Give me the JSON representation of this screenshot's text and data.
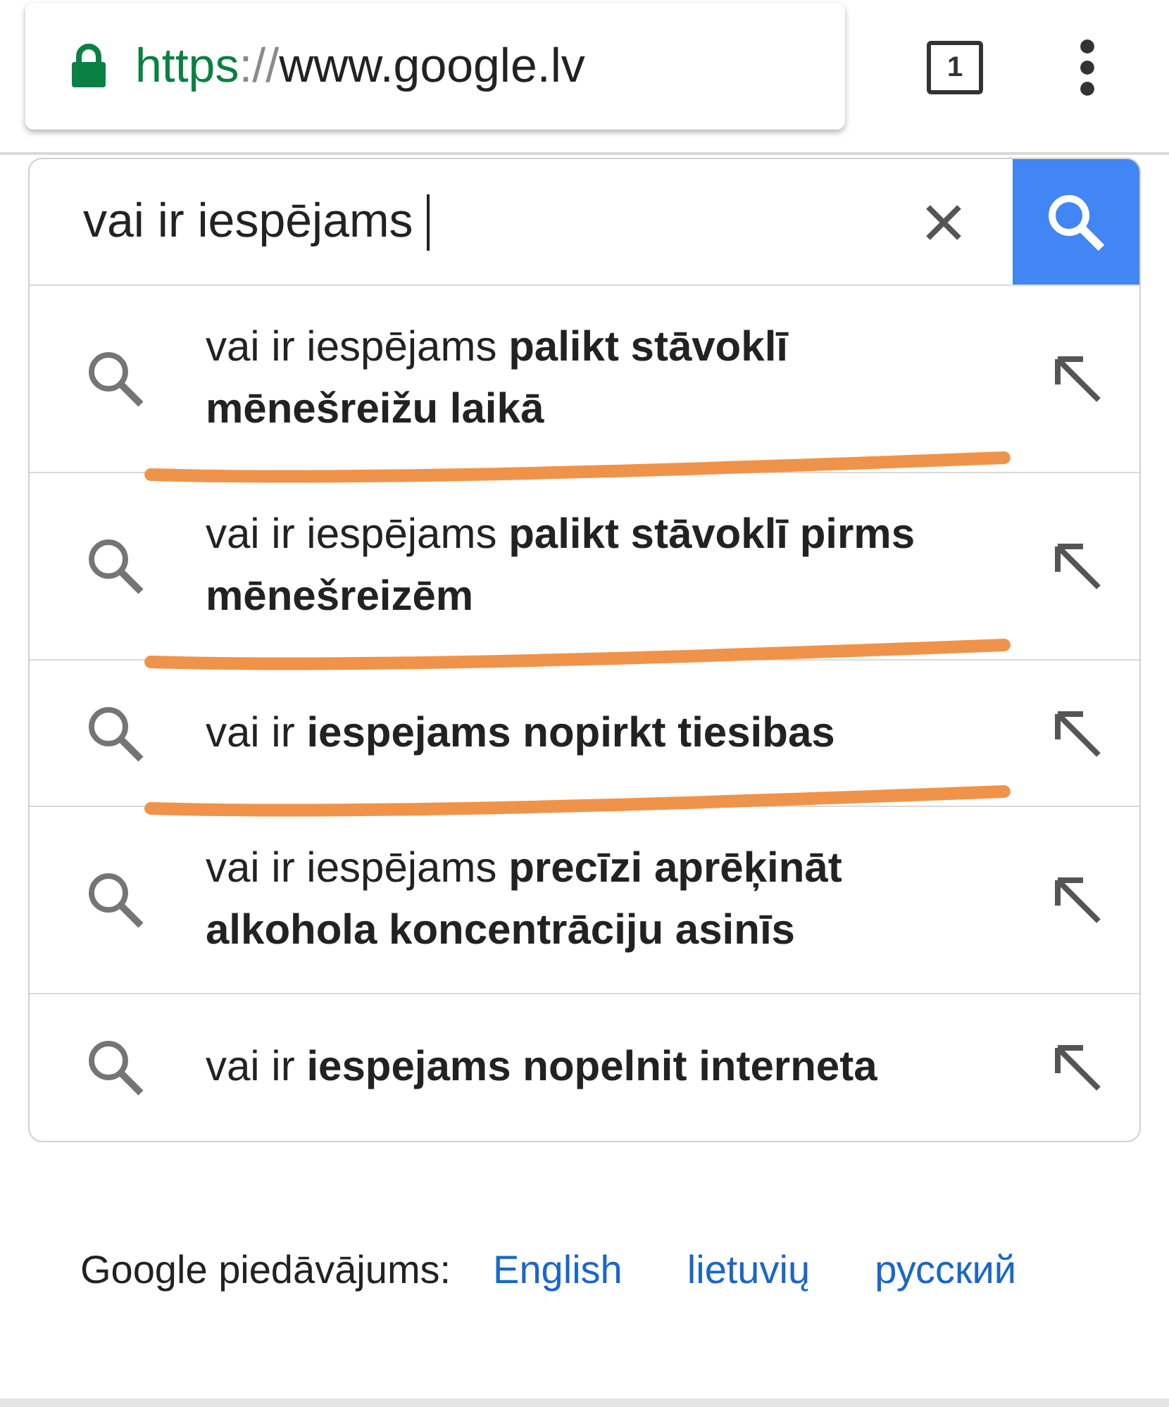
{
  "address_bar": {
    "scheme": "https",
    "separator": "://",
    "host": "www.google.lv",
    "tab_count": "1"
  },
  "search": {
    "value": "vai ir iespējams "
  },
  "suggestions": [
    {
      "text": "vai ir iespējams **palikt stāvoklī mēnešreižu laikā**",
      "underlined": true
    },
    {
      "text": "vai ir iespējams **palikt stāvoklī pirms mēnešreizēm**",
      "underlined": true
    },
    {
      "text": "vai ir **iespejams nopirkt tiesibas**",
      "underlined": true
    },
    {
      "text": "vai ir iespējams **precīzi aprēķināt alkohola koncentrāciju asinīs**",
      "underlined": false
    },
    {
      "text": "vai ir **iespejams nopelnit interneta**",
      "underlined": false
    }
  ],
  "footer": {
    "label": "Google piedāvājums:",
    "languages": [
      "English",
      "lietuvių",
      "русский"
    ]
  }
}
